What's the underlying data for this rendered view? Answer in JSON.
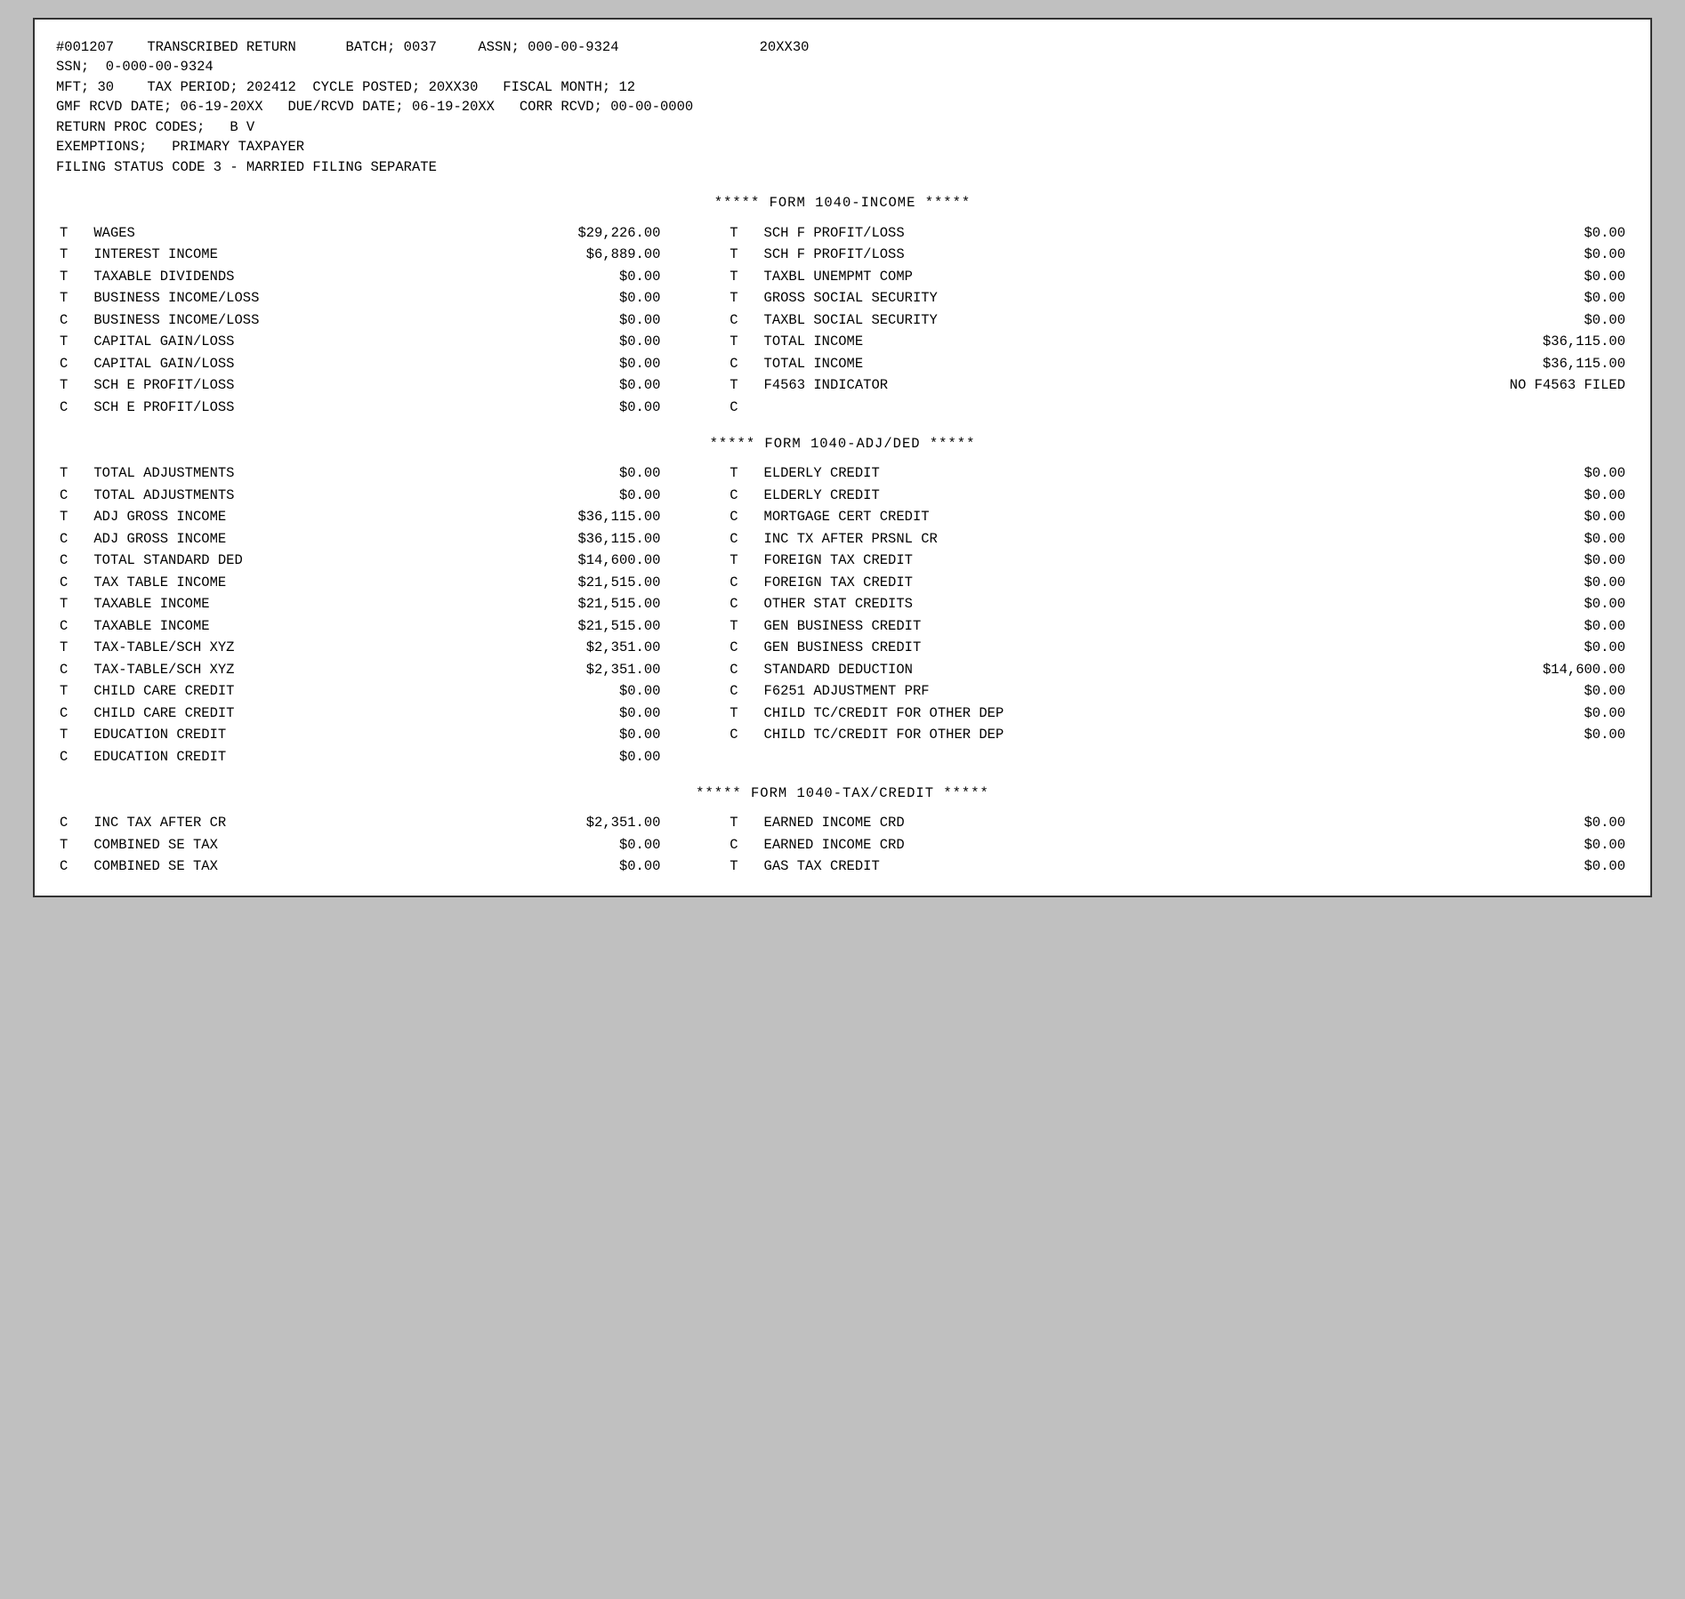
{
  "header": {
    "line1": "#001207    TRANSCRIBED RETURN      BATCH; 0037     ASSN; 000-00-9324                 20XX30",
    "line2": "SSN;  0-000-00-9324",
    "line3": "MFT; 30    TAX PERIOD; 202412  CYCLE POSTED; 20XX30   FISCAL MONTH; 12",
    "line4": "GMF RCVD DATE; 06-19-20XX   DUE/RCVD DATE; 06-19-20XX   CORR RCVD; 00-00-0000",
    "line5": "RETURN PROC CODES;   B V",
    "line6": "EXEMPTIONS;   PRIMARY TAXPAYER",
    "line7": "FILING STATUS CODE 3 - MARRIED FILING SEPARATE"
  },
  "income_section": {
    "title": "*****      FORM 1040-INCOME      *****",
    "rows": [
      {
        "left_ind": "T",
        "left_label": "WAGES",
        "left_val": "$29,226.00",
        "right_ind": "T",
        "right_label": "SCH F PROFIT/LOSS",
        "right_val": "$0.00"
      },
      {
        "left_ind": "T",
        "left_label": "INTEREST INCOME",
        "left_val": "$6,889.00",
        "right_ind": "T",
        "right_label": "SCH F PROFIT/LOSS",
        "right_val": "$0.00"
      },
      {
        "left_ind": "T",
        "left_label": "TAXABLE DIVIDENDS",
        "left_val": "$0.00",
        "right_ind": "T",
        "right_label": "TAXBL UNEMPMT COMP",
        "right_val": "$0.00"
      },
      {
        "left_ind": "T",
        "left_label": "BUSINESS INCOME/LOSS",
        "left_val": "$0.00",
        "right_ind": "T",
        "right_label": "GROSS SOCIAL SECURITY",
        "right_val": "$0.00"
      },
      {
        "left_ind": "C",
        "left_label": "BUSINESS INCOME/LOSS",
        "left_val": "$0.00",
        "right_ind": "C",
        "right_label": "TAXBL SOCIAL SECURITY",
        "right_val": "$0.00"
      },
      {
        "left_ind": "T",
        "left_label": "CAPITAL GAIN/LOSS",
        "left_val": "$0.00",
        "right_ind": "T",
        "right_label": "TOTAL INCOME",
        "right_val": "$36,115.00"
      },
      {
        "left_ind": "C",
        "left_label": "CAPITAL GAIN/LOSS",
        "left_val": "$0.00",
        "right_ind": "C",
        "right_label": "TOTAL INCOME",
        "right_val": "$36,115.00"
      },
      {
        "left_ind": "T",
        "left_label": "SCH E PROFIT/LOSS",
        "left_val": "$0.00",
        "right_ind": "T",
        "right_label": "F4563 INDICATOR",
        "right_val": "NO F4563 FILED"
      },
      {
        "left_ind": "C",
        "left_label": "SCH E PROFIT/LOSS",
        "left_val": "$0.00",
        "right_ind": "C",
        "right_label": "",
        "right_val": ""
      }
    ]
  },
  "adjded_section": {
    "title": "*****      FORM 1040-ADJ/DED      *****",
    "rows": [
      {
        "left_ind": "T",
        "left_label": "TOTAL ADJUSTMENTS",
        "left_val": "$0.00",
        "right_ind": "T",
        "right_label": "ELDERLY CREDIT",
        "right_val": "$0.00"
      },
      {
        "left_ind": "C",
        "left_label": "TOTAL ADJUSTMENTS",
        "left_val": "$0.00",
        "right_ind": "C",
        "right_label": "ELDERLY CREDIT",
        "right_val": "$0.00"
      },
      {
        "left_ind": "T",
        "left_label": "ADJ GROSS INCOME",
        "left_val": "$36,115.00",
        "right_ind": "C",
        "right_label": "MORTGAGE CERT CREDIT",
        "right_val": "$0.00"
      },
      {
        "left_ind": "C",
        "left_label": "ADJ GROSS INCOME",
        "left_val": "$36,115.00",
        "right_ind": "C",
        "right_label": "INC TX AFTER PRSNL CR",
        "right_val": "$0.00"
      },
      {
        "left_ind": "C",
        "left_label": "TOTAL STANDARD DED",
        "left_val": "$14,600.00",
        "right_ind": "T",
        "right_label": "FOREIGN TAX CREDIT",
        "right_val": "$0.00"
      },
      {
        "left_ind": "C",
        "left_label": "TAX TABLE INCOME",
        "left_val": "$21,515.00",
        "right_ind": "C",
        "right_label": "FOREIGN TAX CREDIT",
        "right_val": "$0.00"
      },
      {
        "left_ind": "T",
        "left_label": "TAXABLE INCOME",
        "left_val": "$21,515.00",
        "right_ind": "C",
        "right_label": "OTHER STAT CREDITS",
        "right_val": "$0.00"
      },
      {
        "left_ind": "C",
        "left_label": "TAXABLE INCOME",
        "left_val": "$21,515.00",
        "right_ind": "T",
        "right_label": "GEN BUSINESS CREDIT",
        "right_val": "$0.00"
      },
      {
        "left_ind": "T",
        "left_label": "TAX-TABLE/SCH XYZ",
        "left_val": "$2,351.00",
        "right_ind": "C",
        "right_label": "GEN BUSINESS CREDIT",
        "right_val": "$0.00"
      },
      {
        "left_ind": "C",
        "left_label": "TAX-TABLE/SCH XYZ",
        "left_val": "$2,351.00",
        "right_ind": "C",
        "right_label": "STANDARD DEDUCTION",
        "right_val": "$14,600.00"
      },
      {
        "left_ind": "T",
        "left_label": "CHILD CARE CREDIT",
        "left_val": "$0.00",
        "right_ind": "C",
        "right_label": "F6251 ADJUSTMENT PRF",
        "right_val": "$0.00"
      },
      {
        "left_ind": "C",
        "left_label": "CHILD CARE CREDIT",
        "left_val": "$0.00",
        "right_ind": "T",
        "right_label": "CHILD TC/CREDIT FOR OTHER DEP",
        "right_val": "$0.00"
      },
      {
        "left_ind": "T",
        "left_label": "EDUCATION CREDIT",
        "left_val": "$0.00",
        "right_ind": "C",
        "right_label": "CHILD TC/CREDIT FOR OTHER DEP",
        "right_val": "$0.00"
      },
      {
        "left_ind": "C",
        "left_label": "EDUCATION CREDIT",
        "left_val": "$0.00",
        "right_ind": "",
        "right_label": "",
        "right_val": ""
      }
    ]
  },
  "taxcredit_section": {
    "title": "*****      FORM 1040-TAX/CREDIT      *****",
    "rows": [
      {
        "left_ind": "C",
        "left_label": "INC TAX AFTER CR",
        "left_val": "$2,351.00",
        "right_ind": "T",
        "right_label": "EARNED INCOME CRD",
        "right_val": "$0.00"
      },
      {
        "left_ind": "T",
        "left_label": "COMBINED SE TAX",
        "left_val": "$0.00",
        "right_ind": "C",
        "right_label": "EARNED INCOME CRD",
        "right_val": "$0.00"
      },
      {
        "left_ind": "C",
        "left_label": "COMBINED SE TAX",
        "left_val": "$0.00",
        "right_ind": "T",
        "right_label": "GAS TAX CREDIT",
        "right_val": "$0.00"
      }
    ]
  }
}
